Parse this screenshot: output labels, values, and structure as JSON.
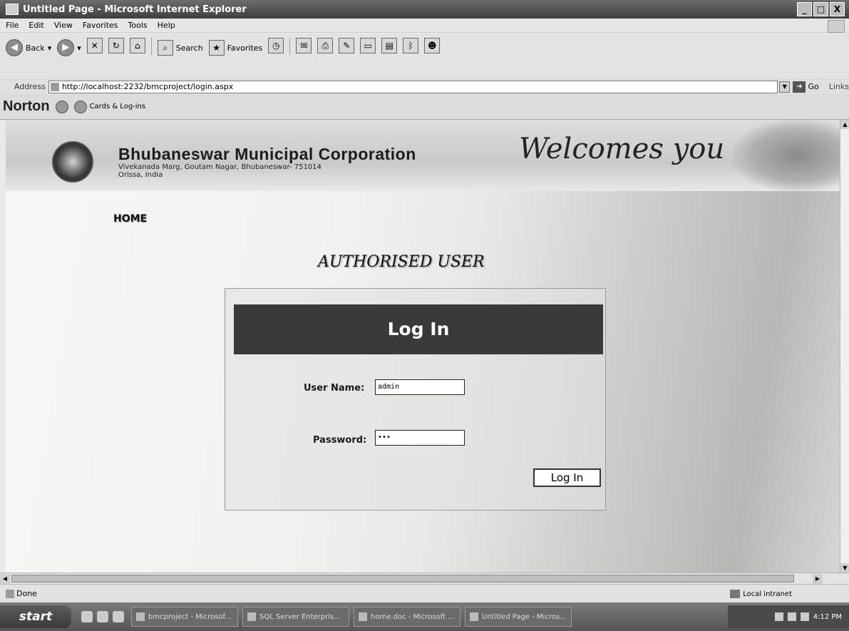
{
  "window": {
    "title": "Untitled Page - Microsoft Internet Explorer",
    "minimize": "_",
    "maximize": "□",
    "close": "X"
  },
  "menu": [
    "File",
    "Edit",
    "View",
    "Favorites",
    "Tools",
    "Help"
  ],
  "toolbar": {
    "back": "Back",
    "search": "Search",
    "favorites": "Favorites"
  },
  "address": {
    "label": "Address",
    "url": "http://localhost:2232/bmcproject/login.aspx",
    "go": "Go",
    "links": "Links"
  },
  "norton": {
    "brand": "Norton",
    "cards": "Cards & Log-ins"
  },
  "page": {
    "org_name": "Bhubaneswar Municipal Corporation",
    "org_address_line1": "Vivekanada Marg, Goutam Nagar, Bhubaneswar- 751014",
    "org_address_line2": "Orissa, India",
    "welcome": "Welcomes you",
    "home": "HOME",
    "section_title": "AUTHORISED USER",
    "login_header": "Log In",
    "username_label": "User Name:",
    "username_value": "admin",
    "password_label": "Password:",
    "password_value": "•••",
    "login_button": "Log In"
  },
  "status": {
    "text": "Done",
    "zone": "Local intranet"
  },
  "taskbar": {
    "start": "start",
    "tasks": [
      "bmcproject - Microsof...",
      "SQL Server Enterpris...",
      "home.doc - Microsoft ...",
      "Untitled Page - Micros..."
    ],
    "clock": "4:12 PM"
  }
}
